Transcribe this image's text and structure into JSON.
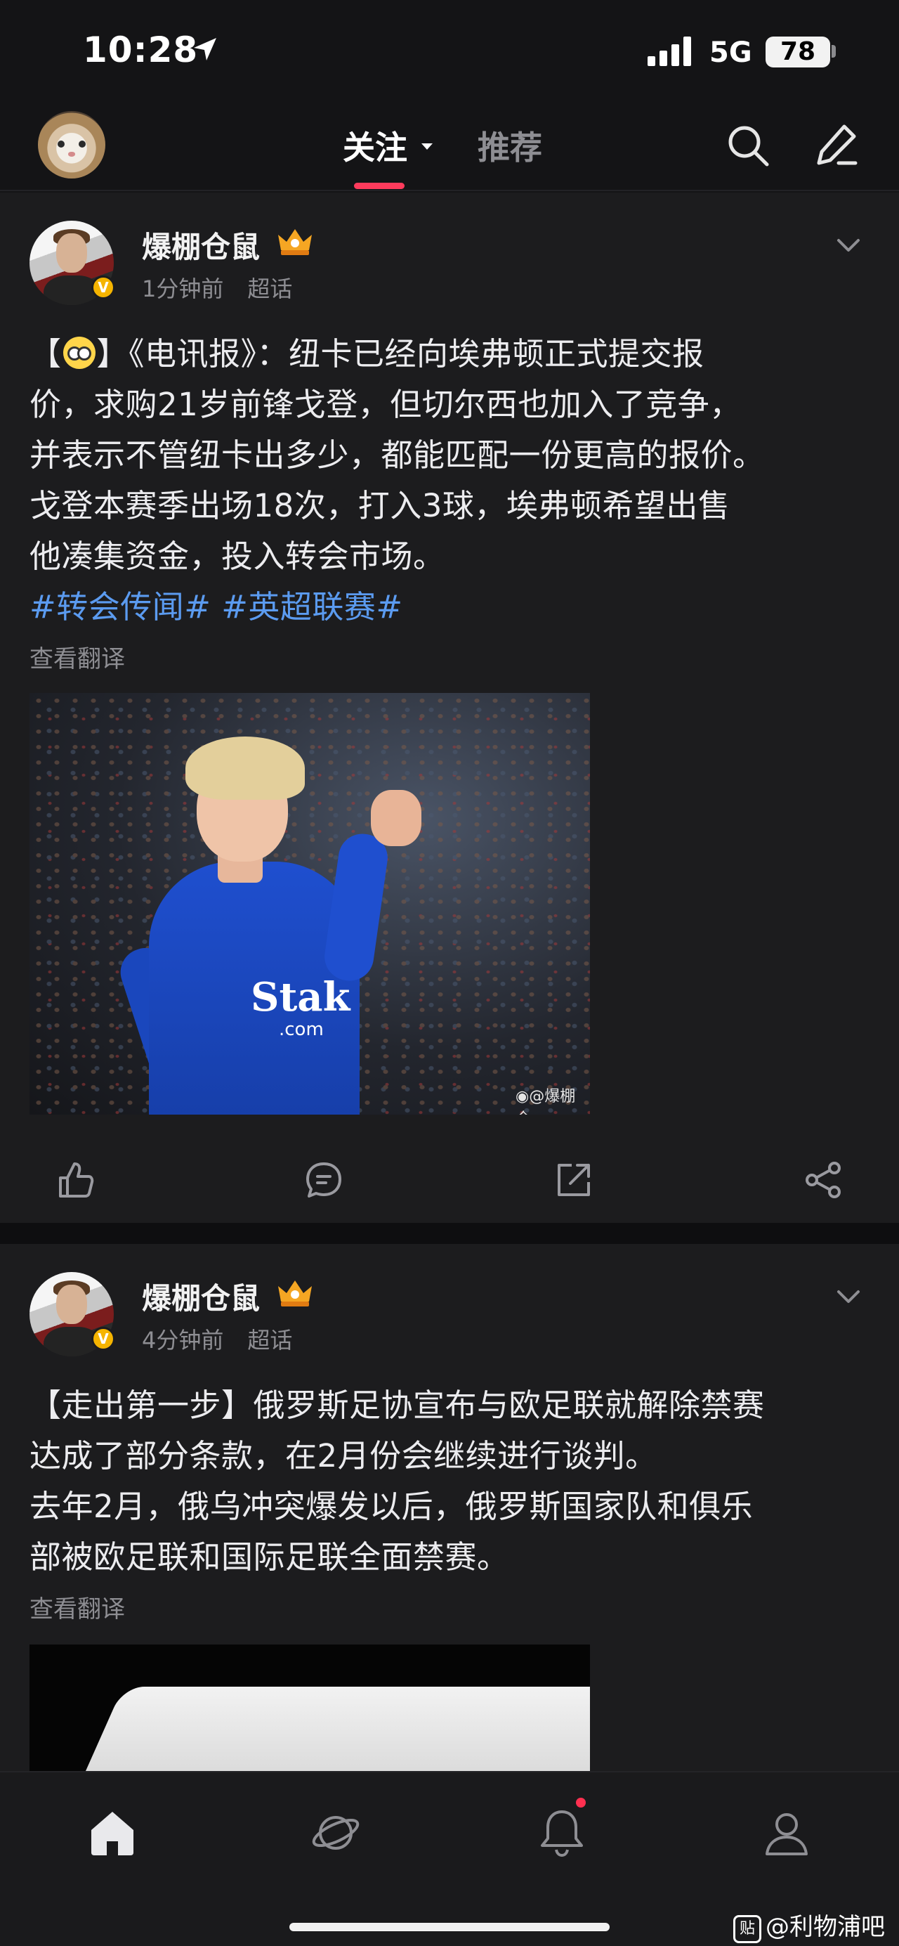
{
  "status_bar": {
    "time": "10:28",
    "network": "5G",
    "battery": "78"
  },
  "nav": {
    "tab_follow": "关注",
    "tab_recommend": "推荐"
  },
  "posts": [
    {
      "username": "爆棚仓鼠",
      "time_ago": "1分钟前",
      "source": "超话",
      "text_lines": [
        "】《电讯报》：纽卡已经向埃弗顿正式提交报",
        "价，求购21岁前锋戈登，但切尔西也加入了竞争，",
        "并表示不管纽卡出多少，都能匹配一份更高的报价。",
        "戈登本赛季出场18次，打入3球，埃弗顿希望出售",
        "他凑集资金，投入转会市场。"
      ],
      "text_prefix": "【",
      "hashtags": "#转会传闻# #英超联赛#",
      "translate": "查看翻译",
      "image": {
        "sponsor": "Stak",
        "sponsor_sub": ".com",
        "watermark": "@爆棚仓"
      }
    },
    {
      "username": "爆棚仓鼠",
      "time_ago": "4分钟前",
      "source": "超话",
      "text_lines": [
        "【走出第一步】俄罗斯足协宣布与欧足联就解除禁赛",
        "达成了部分条款，在2月份会继续进行谈判。",
        "去年2月，俄乌冲突爆发以后，俄罗斯国家队和俱乐",
        "部被欧足联和国际足联全面禁赛。"
      ],
      "translate": "查看翻译"
    }
  ],
  "watermark": {
    "logo": "贴",
    "text": "@利物浦吧"
  },
  "colors": {
    "accent": "#ff3b5c",
    "hashtag": "#5b9bf0",
    "badge": "#f5b400"
  },
  "icons": [
    "location-arrow-icon",
    "signal-icon",
    "search-icon",
    "compose-icon",
    "chevron-down-icon",
    "like-icon",
    "comment-icon",
    "repost-icon",
    "share-icon",
    "home-icon",
    "explore-icon",
    "bell-icon",
    "profile-icon"
  ]
}
